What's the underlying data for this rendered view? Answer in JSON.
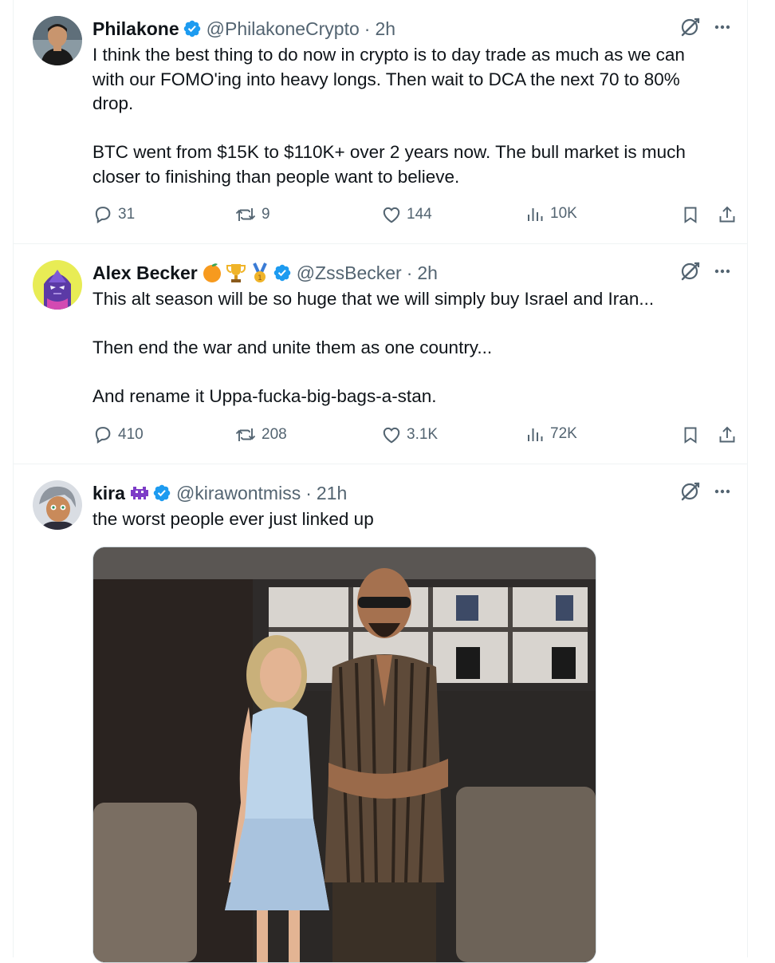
{
  "colors": {
    "accent": "#1d9bf0",
    "text": "#0f1419",
    "muted": "#536471",
    "divider": "#eff3f4"
  },
  "tweets": [
    {
      "name": "Philakone",
      "handle": "@PhilakoneCrypto",
      "separator": "·",
      "time": "2h",
      "text": "I think the best thing to do now in crypto is to day trade as much as we can\nwith our FOMO'ing into heavy longs. Then wait to DCA the next 70 to 80%\ndrop.\n\nBTC went from $15K to $110K+ over 2 years now. The bull market is much\ncloser to finishing than people want to believe.",
      "replies": "31",
      "reposts": "9",
      "likes": "144",
      "views": "10K"
    },
    {
      "name": "Alex Becker",
      "badges": [
        "orange-emoji",
        "trophy-emoji",
        "medal-emoji"
      ],
      "handle": "@ZssBecker",
      "separator": "·",
      "time": "2h",
      "text": "This alt season will be so huge that we will simply buy Israel and Iran...\n\nThen end the war and unite them as one country...\n\nAnd rename it  Uppa-fucka-big-bags-a-stan.",
      "replies": "410",
      "reposts": "208",
      "likes": "3.1K",
      "views": "72K"
    },
    {
      "name": "kira",
      "badges": [
        "space-invader-emoji"
      ],
      "handle": "@kirawontmiss",
      "separator": "·",
      "time": "21h",
      "text": "the worst people ever just linked up"
    }
  ],
  "icons": [
    "grok-icon",
    "more-icon",
    "reply-icon",
    "repost-icon",
    "like-icon",
    "views-icon",
    "bookmark-icon",
    "share-icon",
    "verified-icon"
  ]
}
